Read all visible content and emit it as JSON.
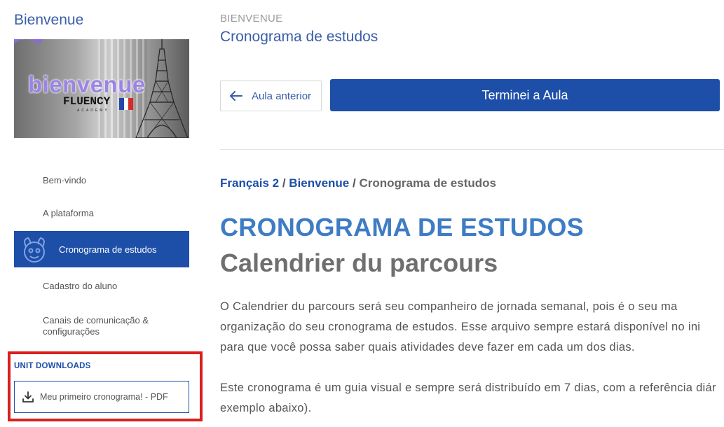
{
  "sidebar": {
    "title": "Bienvenue",
    "banner": {
      "word": "bienvenue",
      "logo": "FLUENCY",
      "sub": "ACADEMY"
    },
    "nav": [
      {
        "label": "Bem-vindo",
        "active": false
      },
      {
        "label": "A plataforma",
        "active": false
      },
      {
        "label": "Cronograma de estudos",
        "active": true
      },
      {
        "label": "Cadastro do aluno",
        "active": false
      },
      {
        "label": "Canais de comunicação & configurações",
        "active": false
      }
    ],
    "downloads": {
      "heading": "UNIT DOWNLOADS",
      "items": [
        {
          "label": "Meu primeiro cronograma! - PDF",
          "icon": "download-icon"
        }
      ]
    }
  },
  "main": {
    "eyebrow": "BIENVENUE",
    "title": "Cronograma de estudos",
    "prev_button": "Aula anterior",
    "done_button": "Terminei a Aula",
    "breadcrumb": {
      "course": "Français 2",
      "sep1": " / ",
      "unit": "Bienvenue",
      "sep2": " / ",
      "current": "Cronograma de estudos"
    },
    "heading": "CRONOGRAMA DE ESTUDOS",
    "subheading": "Calendrier du parcours",
    "paragraphs": [
      [
        "O Calendrier du parcours será seu companheiro de jornada semanal, pois é o seu ma",
        "organização do seu cronograma de estudos. Esse arquivo sempre estará disponível no ini",
        "para que você possa saber quais atividades deve fazer em cada um dos dias."
      ],
      [
        "Este cronograma é um guia visual e sempre será distribuído em 7 dias, com a referência diár",
        "exemplo abaixo)."
      ]
    ]
  },
  "colors": {
    "brand_blue": "#1d4fa8",
    "heading_blue": "#3e7cc4",
    "highlight_red": "#d9201f"
  }
}
